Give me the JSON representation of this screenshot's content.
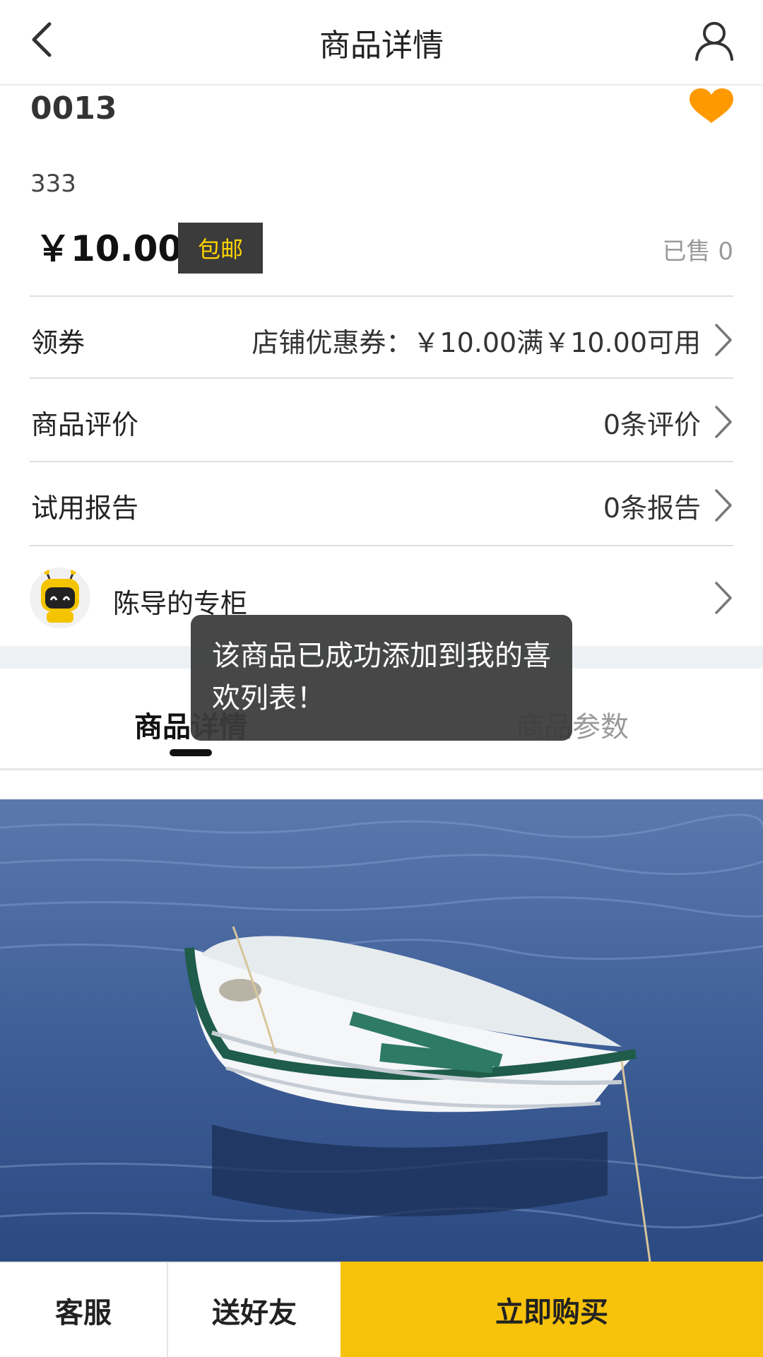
{
  "header": {
    "title": "商品详情",
    "back_icon": "chevron-left-icon",
    "user_icon": "user-icon"
  },
  "product": {
    "name": "0013",
    "description": "333",
    "price": "￥10.00",
    "free_shipping": "包邮",
    "sold": "已售 0",
    "favorite_color": "#ff9900"
  },
  "rows": {
    "coupon": {
      "label": "领券",
      "value": "店铺优惠券：￥10.00满￥10.00可用"
    },
    "reviews": {
      "label": "商品评价",
      "value": "0条评价"
    },
    "trial": {
      "label": "试用报告",
      "value": "0条报告"
    }
  },
  "shop": {
    "name": "陈导的专柜"
  },
  "tabs": [
    {
      "label": "商品详情",
      "active": true
    },
    {
      "label": "商品参数",
      "active": false
    }
  ],
  "toast": {
    "message": "该商品已成功添加到我的喜欢列表！"
  },
  "bottom_bar": {
    "service": "客服",
    "share": "送好友",
    "buy": "立即购买",
    "buy_color": "#f7c20a"
  }
}
